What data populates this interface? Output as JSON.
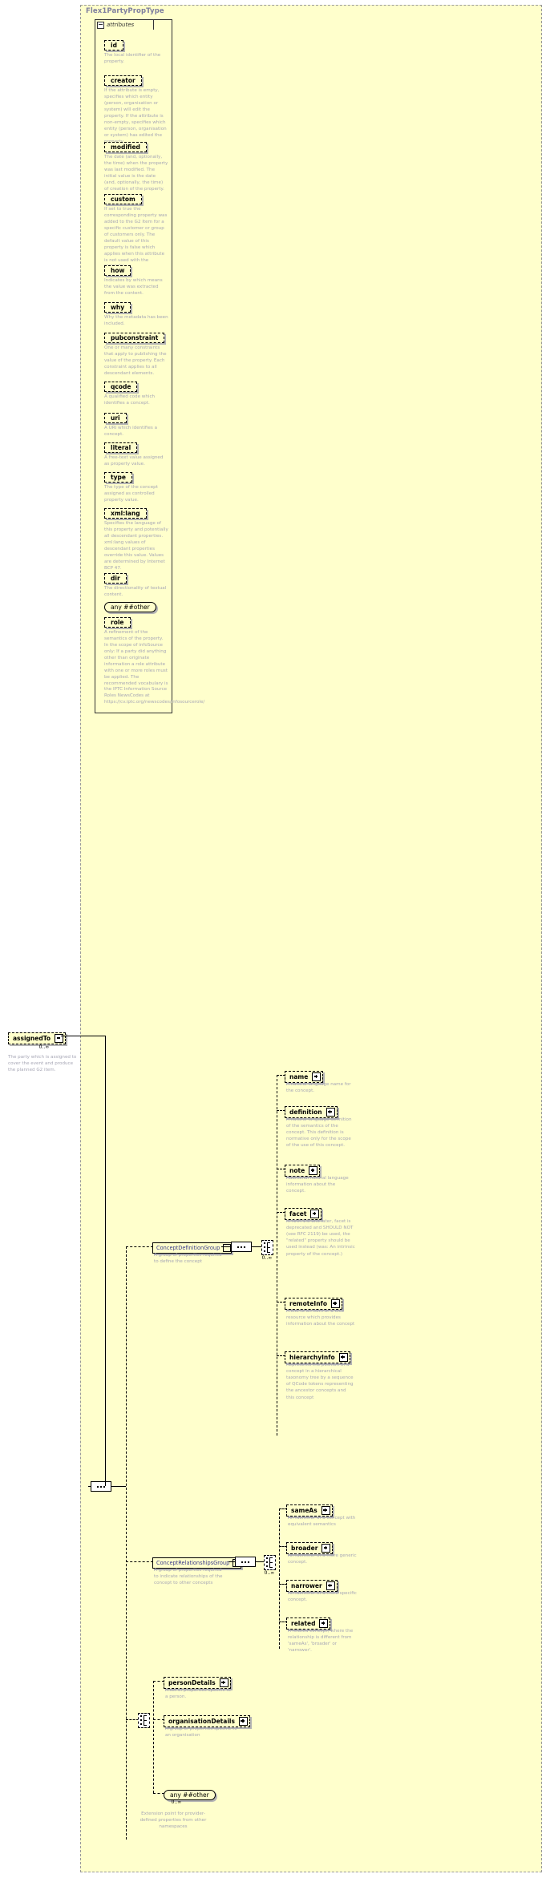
{
  "type": {
    "name": "Flex1PartyPropType",
    "attributes_label": "attributes",
    "attributes": [
      {
        "name": "id",
        "desc": "The local identifier of the property."
      },
      {
        "name": "creator",
        "desc": "If the attribute is empty, specifies which entity (person, organisation or system) will edit the property. If the attribute is non-empty, specifies which entity (person, organisation or system) has edited the property."
      },
      {
        "name": "modified",
        "desc": "The date (and, optionally, the time) when the property was last modified. The initial value is the date (and, optionally, the time) of creation of the property."
      },
      {
        "name": "custom",
        "desc": "If set to true the corresponding property was added to the G2 Item for a specific customer or group of customers only. The default value of this property is false which applies when this attribute is not used with the property."
      },
      {
        "name": "how",
        "desc": "Indicates by which means the value was extracted from the content."
      },
      {
        "name": "why",
        "desc": "Why the metadata has been included."
      },
      {
        "name": "pubconstraint",
        "desc": "One or many constraints that apply to publishing the value of the property. Each constraint applies to all descendant elements."
      },
      {
        "name": "qcode",
        "desc": "A qualified code which identifies a concept."
      },
      {
        "name": "uri",
        "desc": "A URI which identifies a concept."
      },
      {
        "name": "literal",
        "desc": "A free-text value assigned as property value."
      },
      {
        "name": "type",
        "desc": "The type of the concept assigned as controlled property value."
      },
      {
        "name": "xml:lang",
        "desc": "Specifies the language of this property and potentially all descendant properties. xml:lang values of descendant properties override this value. Values are determined by Internet BCP 47."
      },
      {
        "name": "dir",
        "desc": "The directionality of textual content."
      },
      {
        "name": "any ##other",
        "kind": "any",
        "desc": ""
      },
      {
        "name": "role",
        "desc": "A refinement of the semantics of the property. In the scope of infoSource only: If a party did anything other than originate information a role attribute with one or more roles must be applied. The recommended vocabulary is the IPTC Information Source Roles NewsCodes at https://cv.iptc.org/newscodes/infosourcerole/"
      }
    ]
  },
  "assignedTo": {
    "label": "assignedTo",
    "cardinality": "0..∞",
    "desc": "The party which is assigned to cover the event and produce the planned G2 item."
  },
  "groups": {
    "conceptDefinition": {
      "label": "ConceptDefinitionGroup",
      "desc": "A group of properties required to define the concept",
      "cardinality": "0..∞",
      "children": [
        {
          "label": "name",
          "desc": "A natural language name for the concept."
        },
        {
          "label": "definition",
          "desc": "A natural language definition of the semantics of the concept. This definition is normative only for the scope of the use of this concept."
        },
        {
          "label": "note",
          "desc": "Additional natural language information about the concept."
        },
        {
          "label": "facet",
          "desc": "In NAR 1.8 and later, facet is deprecated and SHOULD NOT (see RFC 2119) be used, the \"related\" property should be used instead (was: An intrinsic property of the concept.)"
        },
        {
          "label": "remoteInfo",
          "desc": "A link to an item or a web resource which provides information about the concept"
        },
        {
          "label": "hierarchyInfo",
          "desc": "Represents the position of a concept in a hierarchical taxonomy tree by a sequence of QCode tokens representing the ancestor concepts and this concept"
        }
      ]
    },
    "conceptRelationships": {
      "label": "ConceptRelationshipsGroup",
      "desc": "A group of properties required to indicate relationships of the concept to other concepts",
      "cardinality": "0..∞",
      "children": [
        {
          "label": "sameAs",
          "desc": "An identifier of a concept with equivalent semantics"
        },
        {
          "label": "broader",
          "desc": "An identifier of a more generic concept."
        },
        {
          "label": "narrower",
          "desc": "An identifier of a more specific concept."
        },
        {
          "label": "related",
          "desc": "A related concept, where the relationship is different from 'sameAs', 'broader' or 'narrower'."
        }
      ]
    }
  },
  "details": [
    {
      "label": "personDetails",
      "desc": "A set of properties specific to a person."
    },
    {
      "label": "organisationDetails",
      "desc": "A group of properties specific to an organisation"
    }
  ],
  "extension": {
    "label": "any ##other",
    "prefix": "any",
    "name": "##other",
    "cardinality": "0..∞",
    "desc": "Extension point for provider-defined properties from other namespaces"
  }
}
